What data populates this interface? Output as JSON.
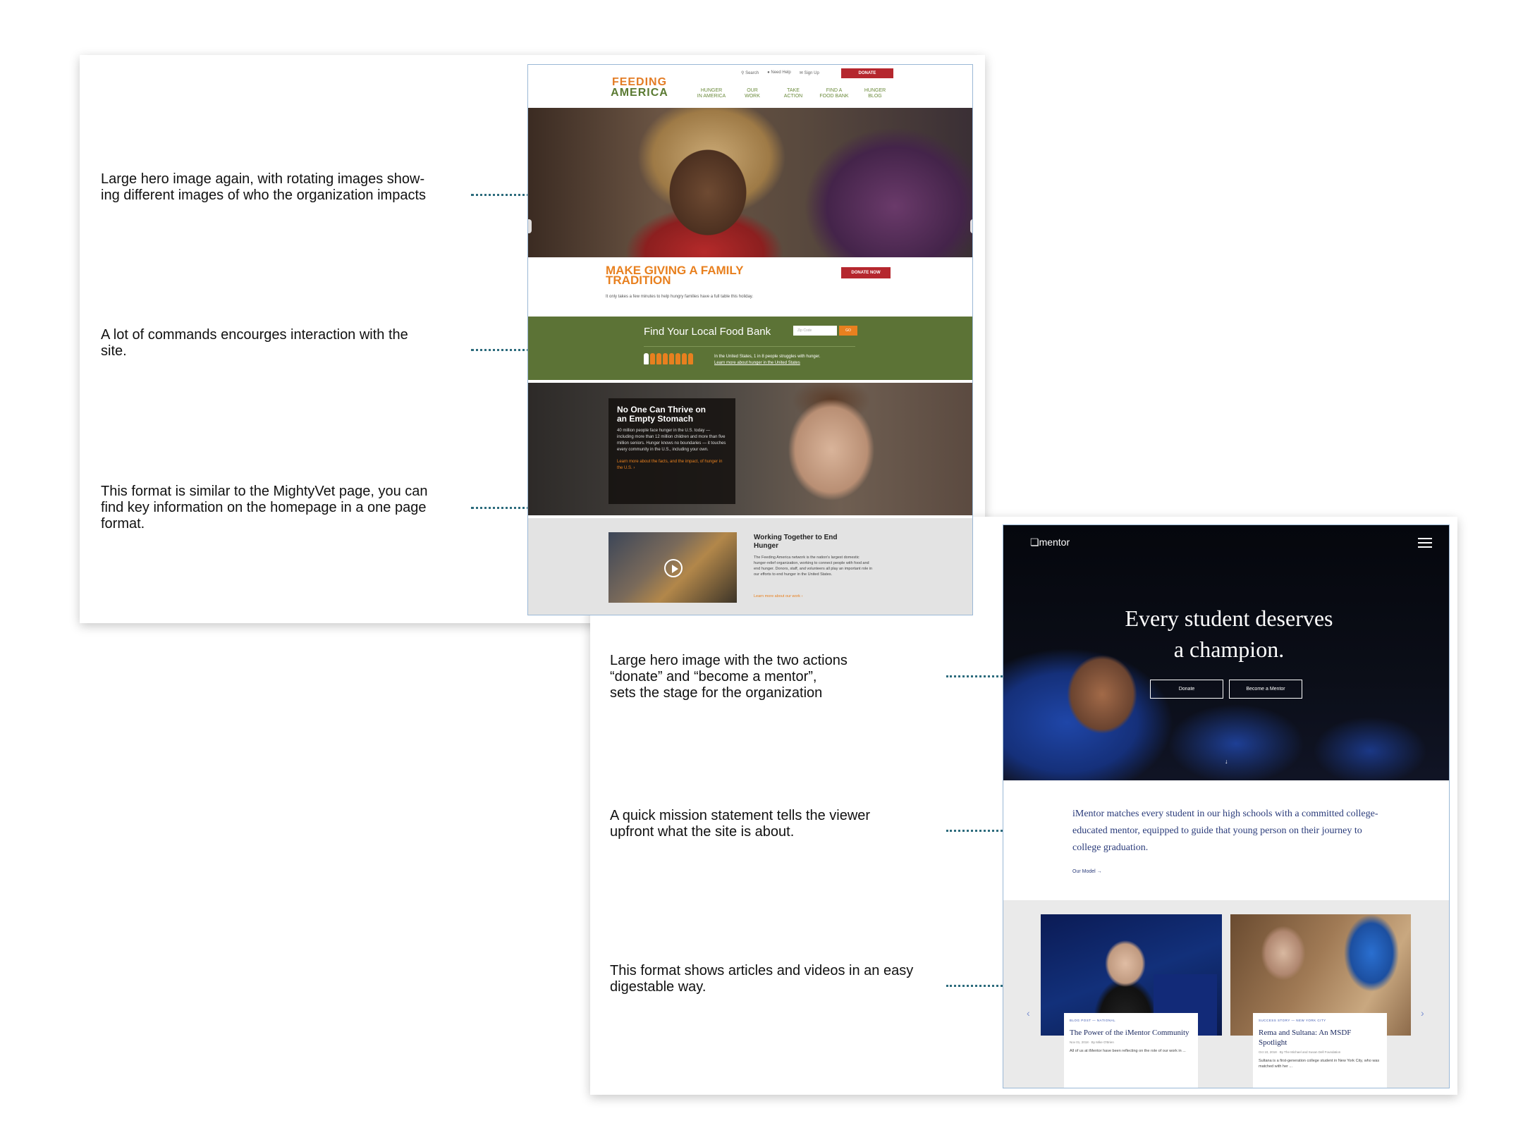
{
  "annotations": {
    "a1": [
      "Large hero image again, with rotating images show-",
      "ing different images of who the organization impacts"
    ],
    "a2": [
      "A lot of commands encourges interaction with the",
      "site."
    ],
    "a3": [
      "This format is similar to the MightyVet page, you can",
      "find key information on the homepage in a one page",
      "format."
    ],
    "a4": [
      "Large hero image with the two actions",
      "“donate” and “become a mentor”,",
      "sets the stage for the organization"
    ],
    "a5": [
      "A quick mission statement tells the viewer",
      "upfront what the site is about."
    ],
    "a6": [
      "This format shows articles and videos in an easy",
      "digestable way."
    ]
  },
  "feeding_america": {
    "util": {
      "search": "Search",
      "need_help": "Need Help",
      "sign_up": "Sign Up",
      "donate": "DONATE"
    },
    "logo": {
      "line1": "FEEDING",
      "line2": "AMERICA"
    },
    "nav": [
      [
        "HUNGER",
        "IN AMERICA"
      ],
      [
        "OUR",
        "WORK"
      ],
      [
        "TAKE",
        "ACTION"
      ],
      [
        "FIND A",
        "FOOD BANK"
      ],
      [
        "HUNGER",
        "BLOG"
      ]
    ],
    "giving_title": [
      "MAKE GIVING A FAMILY",
      "TRADITION"
    ],
    "giving_sub": "It only takes a few minutes to help hungry families have a full table this holiday.",
    "donate_now": "DONATE NOW",
    "foodbank": {
      "title": "Find Your Local Food Bank",
      "placeholder": "Zip Code",
      "go": "GO",
      "stat": "In the United States, 1 in 8 people struggles with hunger.",
      "link": "Learn more about hunger in the United States"
    },
    "thrive": {
      "title": [
        "No One Can Thrive on",
        "an Empty Stomach"
      ],
      "body": "40 million people face hunger in the U.S. today — including more than 12 million children and more than five million seniors. Hunger knows no boundaries — it touches every community in the U.S., including your own.",
      "link": "Learn more about the facts, and the impact, of hunger in the U.S. ›"
    },
    "working": {
      "title": "Working Together to End Hunger",
      "body": "The Feeding America network is the nation's largest domestic hunger-relief organization, working to connect people with food and end hunger. Donors, staff, and volunteers all play an important role in our efforts to end hunger in the United States.",
      "link": "Learn more about our work ›"
    }
  },
  "imentor": {
    "logo": "mentor",
    "headline": [
      "Every student deserves",
      "a champion."
    ],
    "donate": "Donate",
    "become": "Become a Mentor",
    "mission": "iMentor matches every student in our high schools with a committed college-educated mentor, equipped to guide that young person on their journey to college graduation.",
    "model": "Our Model →",
    "articles": [
      {
        "category": "BLOG POST — NATIONAL",
        "title": "The Power of the iMentor Community",
        "meta": "Nov 01, 2018 · By Mike O'Brien",
        "text": "All of us at iMentor have been reflecting on the role of our work in ..."
      },
      {
        "category": "SUCCESS STORY — NEW YORK CITY",
        "title": "Rema and Sultana: An MSDF Spotlight",
        "meta": "Oct 10, 2018 · By The Michael and Susan Dell Foundation",
        "text": "Sultana is a first-generation college student in New York City, who was matched with her ..."
      }
    ]
  }
}
